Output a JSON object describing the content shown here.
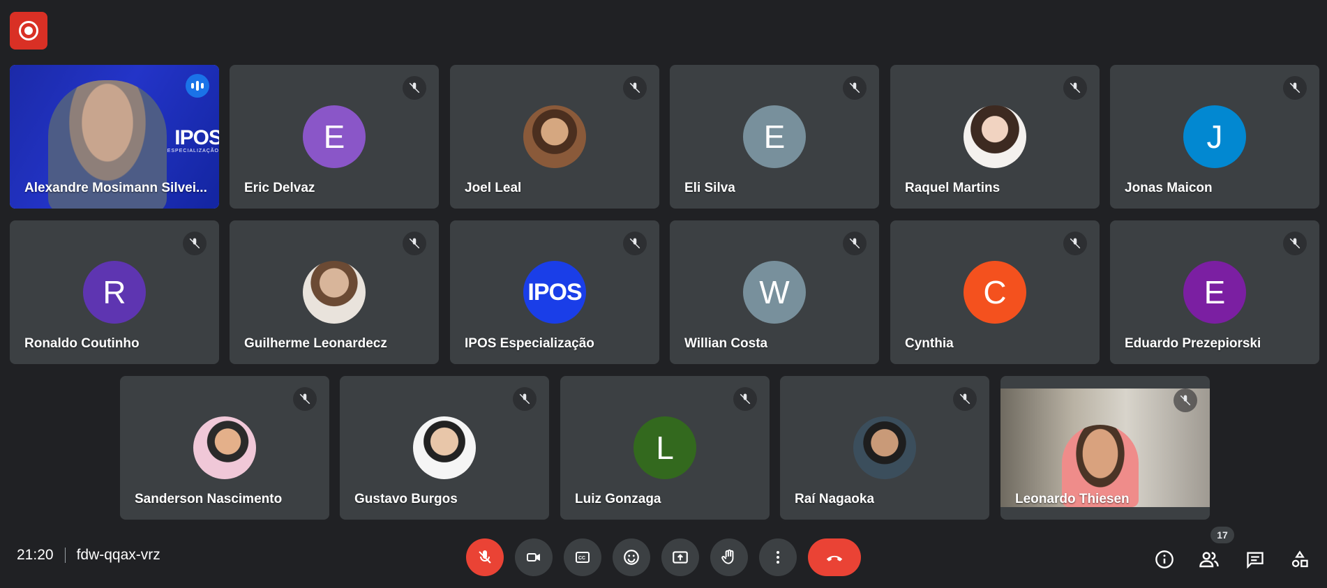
{
  "meeting": {
    "time": "21:20",
    "code": "fdw-qqax-vrz",
    "participant_count": "17"
  },
  "colors": {
    "background": "#202124",
    "tile": "#3c4043",
    "active_border": "#8ab4f8",
    "danger": "#ea4335"
  },
  "participants": [
    {
      "name": "Alexandre Mosimann Silvei...",
      "type": "video-main",
      "speaking": true
    },
    {
      "name": "Eric Delvaz",
      "initial": "E",
      "color": "#8a56c8"
    },
    {
      "name": "Joel Leal",
      "type": "photo"
    },
    {
      "name": "Eli Silva",
      "initial": "E",
      "color": "#78909c"
    },
    {
      "name": "Raquel Martins",
      "type": "photo"
    },
    {
      "name": "Jonas Maicon",
      "initial": "J",
      "color": "#0288d1"
    },
    {
      "name": "Ronaldo Coutinho",
      "initial": "R",
      "color": "#5e35b1"
    },
    {
      "name": "Guilherme Leonardecz",
      "type": "photo"
    },
    {
      "name": "IPOS Especialização",
      "type": "logo",
      "logo_text": "IPOS"
    },
    {
      "name": "Willian Costa",
      "initial": "W",
      "color": "#78909c"
    },
    {
      "name": "Cynthia",
      "initial": "C",
      "color": "#f4511e"
    },
    {
      "name": "Eduardo Prezepiorski",
      "initial": "E",
      "color": "#7b1fa2"
    },
    {
      "name": "Sanderson Nascimento",
      "type": "photo"
    },
    {
      "name": "Gustavo Burgos",
      "type": "photo"
    },
    {
      "name": "Luiz Gonzaga",
      "initial": "L",
      "color": "#33691e"
    },
    {
      "name": "Raí Nagaoka",
      "type": "photo"
    },
    {
      "name": "Leonardo Thiesen",
      "type": "video-cam"
    }
  ],
  "main_video": {
    "brand": "IPOS",
    "brand_sub": "ESPECIALIZAÇÃO"
  },
  "controls": [
    "mic-off",
    "camera",
    "captions",
    "emoji",
    "present",
    "raise-hand",
    "more",
    "end-call"
  ],
  "side_icons": [
    "info",
    "people",
    "chat",
    "activities"
  ]
}
